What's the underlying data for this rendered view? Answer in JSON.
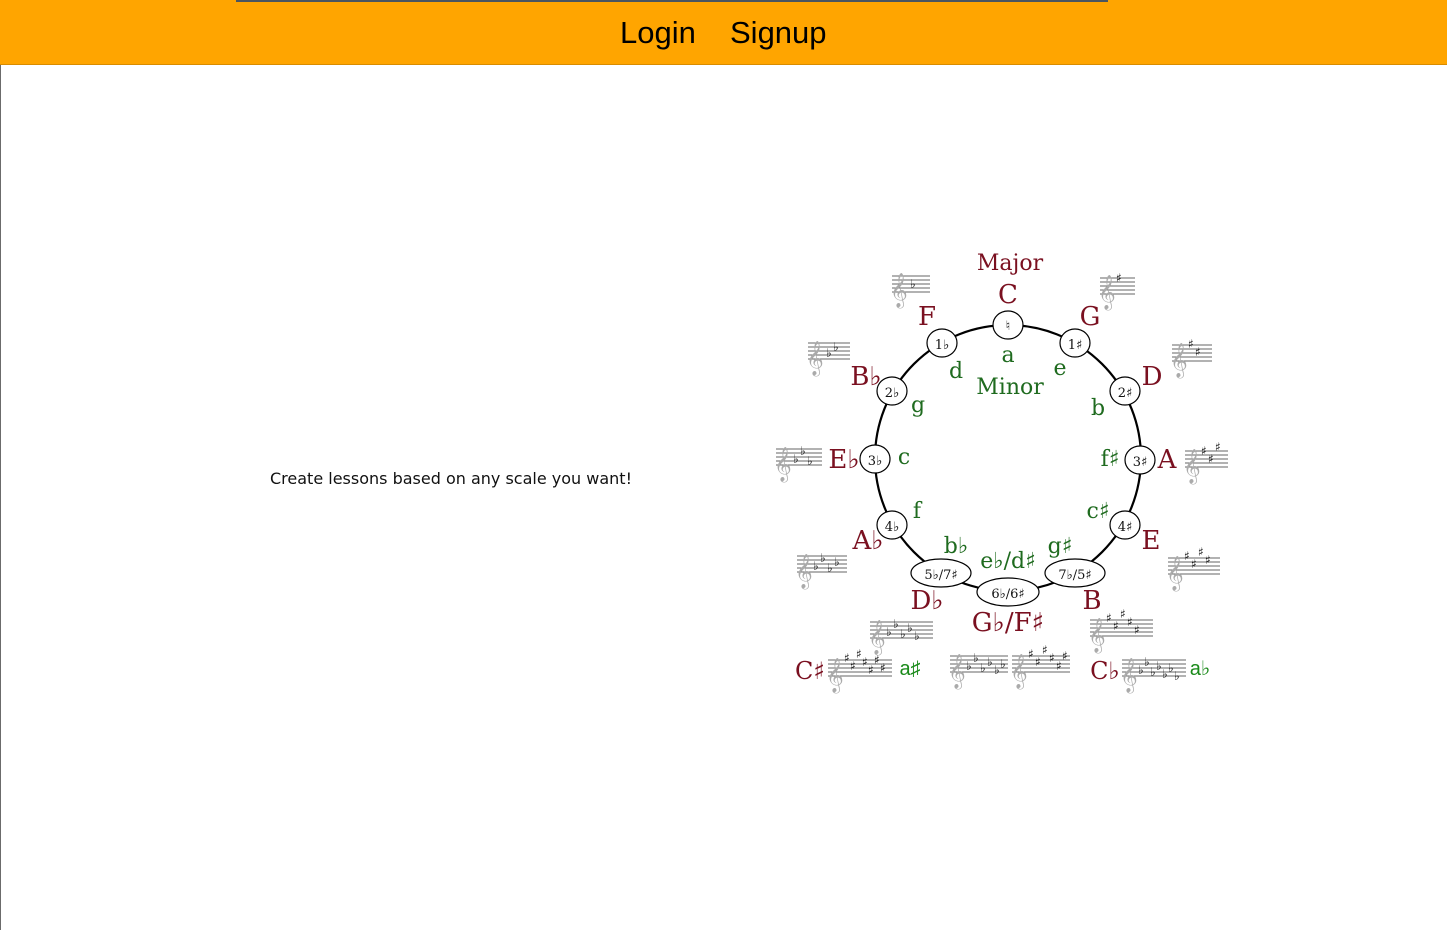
{
  "nav": {
    "login": "Login",
    "signup": "Signup"
  },
  "main": {
    "tagline": "Create lessons based on any scale you want!"
  },
  "circle": {
    "major_title": "Major",
    "minor_title": "Minor",
    "colors": {
      "major": "#7a1020",
      "minor": "#1f6b1f",
      "navbar": "#ffa500"
    },
    "positions": [
      {
        "id": "c",
        "major": "C",
        "minor": "a",
        "sig": "♮"
      },
      {
        "id": "g",
        "major": "G",
        "minor": "e",
        "sig": "1♯"
      },
      {
        "id": "d",
        "major": "D",
        "minor": "b",
        "sig": "2♯"
      },
      {
        "id": "a",
        "major": "A",
        "minor": "f♯",
        "sig": "3♯"
      },
      {
        "id": "e",
        "major": "E",
        "minor": "c♯",
        "sig": "4♯"
      },
      {
        "id": "b",
        "major": "B",
        "minor": "g♯",
        "sig": "7♭/5♯"
      },
      {
        "id": "gb",
        "major": "G♭/F♯",
        "minor": "e♭/d♯",
        "sig": "6♭/6♯"
      },
      {
        "id": "db",
        "major": "D♭",
        "minor": "b♭",
        "sig": "5♭/7♯"
      },
      {
        "id": "ab",
        "major": "A♭",
        "minor": "f",
        "sig": "4♭"
      },
      {
        "id": "eb",
        "major": "E♭",
        "minor": "c",
        "sig": "3♭"
      },
      {
        "id": "bb",
        "major": "B♭",
        "minor": "g",
        "sig": "2♭"
      },
      {
        "id": "f",
        "major": "F",
        "minor": "d",
        "sig": "1♭"
      }
    ],
    "enharmonic": [
      {
        "id": "cs",
        "major": "C♯",
        "minor": "a♯"
      },
      {
        "id": "cb",
        "major": "C♭",
        "minor": "a♭"
      }
    ]
  }
}
